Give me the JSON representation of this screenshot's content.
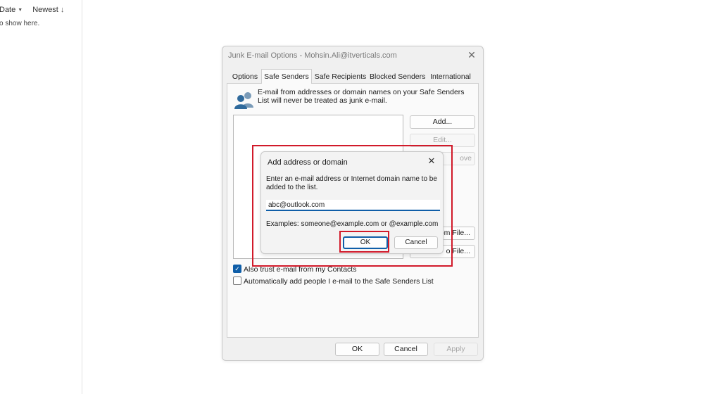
{
  "outlook": {
    "sort_label": "Date",
    "order_label": "Newest",
    "empty_message": "o show here."
  },
  "dialog": {
    "title": "Junk E-mail Options - Mohsin.Ali@itverticals.com",
    "tabs": [
      {
        "label": "Options"
      },
      {
        "label": "Safe Senders"
      },
      {
        "label": "Safe Recipients"
      },
      {
        "label": "Blocked Senders"
      },
      {
        "label": "International"
      }
    ],
    "info_text": "E-mail from addresses or domain names on your Safe Senders List will never be treated as junk e-mail.",
    "buttons": {
      "add": "Add...",
      "edit": "Edit...",
      "remove_partial": "ove",
      "import_partial": "om File...",
      "export_partial": "o File..."
    },
    "checkboxes": {
      "trust_contacts": {
        "label": "Also trust e-mail from my Contacts",
        "checked": true
      },
      "auto_add": {
        "label": "Automatically add people I e-mail to the Safe Senders List",
        "checked": false
      }
    },
    "footer": {
      "ok": "OK",
      "cancel": "Cancel",
      "apply": "Apply"
    }
  },
  "add_dialog": {
    "title": "Add address or domain",
    "instructions": "Enter an e-mail address or Internet domain name to be added to the list.",
    "input_value": "abc@outlook.com",
    "examples": "Examples: someone@example.com or @example.com",
    "ok": "OK",
    "cancel": "Cancel"
  },
  "colors": {
    "accent": "#0f5ea8",
    "highlight": "#d11a2a"
  }
}
